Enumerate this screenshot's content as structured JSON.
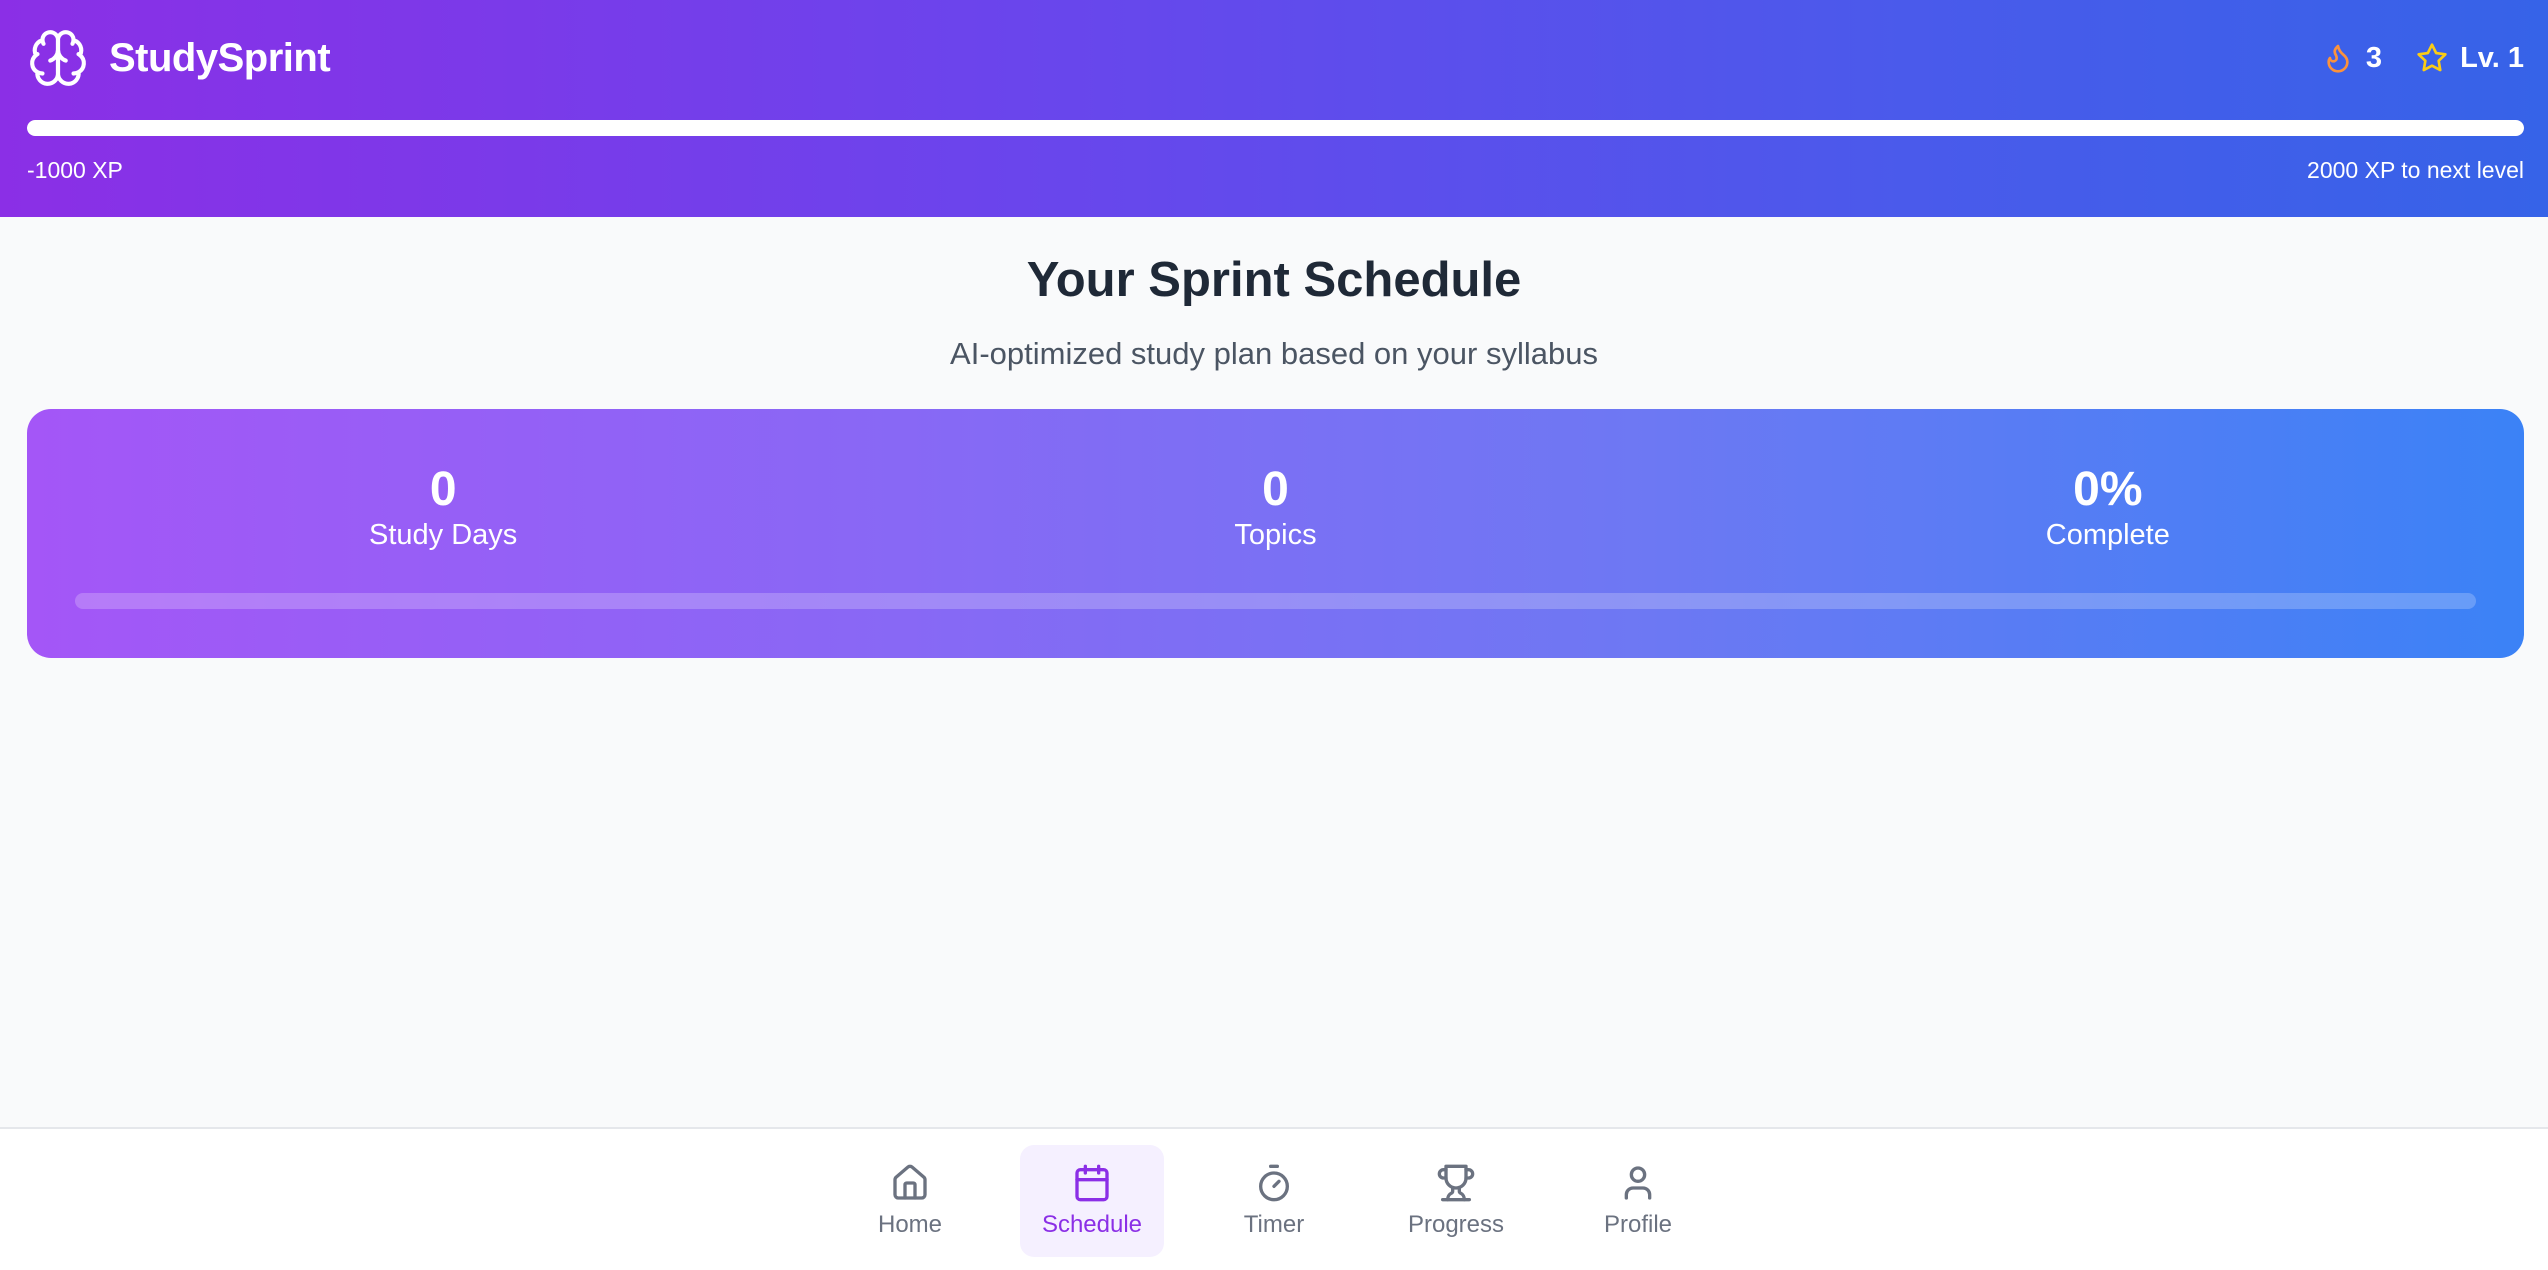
{
  "app": {
    "name": "StudySprint",
    "logo_icon": "brain-icon"
  },
  "header": {
    "streak": {
      "icon": "flame-icon",
      "value": "3",
      "color": "#fb923c"
    },
    "level": {
      "icon": "star-icon",
      "label": "Lv. 1",
      "color": "#facc15"
    },
    "xp": {
      "current_label": "-1000 XP",
      "next_label": "2000 XP to next level",
      "progress_fraction": 1.0
    },
    "gradient_colors": [
      "#8b2fe6",
      "#3663e8"
    ]
  },
  "main": {
    "title": "Your Sprint Schedule",
    "subtitle": "AI-optimized study plan based on your syllabus",
    "summary": {
      "stats": [
        {
          "value": "0",
          "label": "Study Days"
        },
        {
          "value": "0",
          "label": "Topics"
        },
        {
          "value": "0%",
          "label": "Complete"
        }
      ],
      "progress_fraction": 0.0,
      "gradient_colors": [
        "#a456f7",
        "#3b82f6"
      ]
    }
  },
  "nav": {
    "active": "Schedule",
    "accent_color": "#8b2fe6",
    "items": [
      {
        "label": "Home",
        "icon": "home-icon"
      },
      {
        "label": "Schedule",
        "icon": "calendar-icon"
      },
      {
        "label": "Timer",
        "icon": "timer-icon"
      },
      {
        "label": "Progress",
        "icon": "trophy-icon"
      },
      {
        "label": "Profile",
        "icon": "user-icon"
      }
    ]
  }
}
